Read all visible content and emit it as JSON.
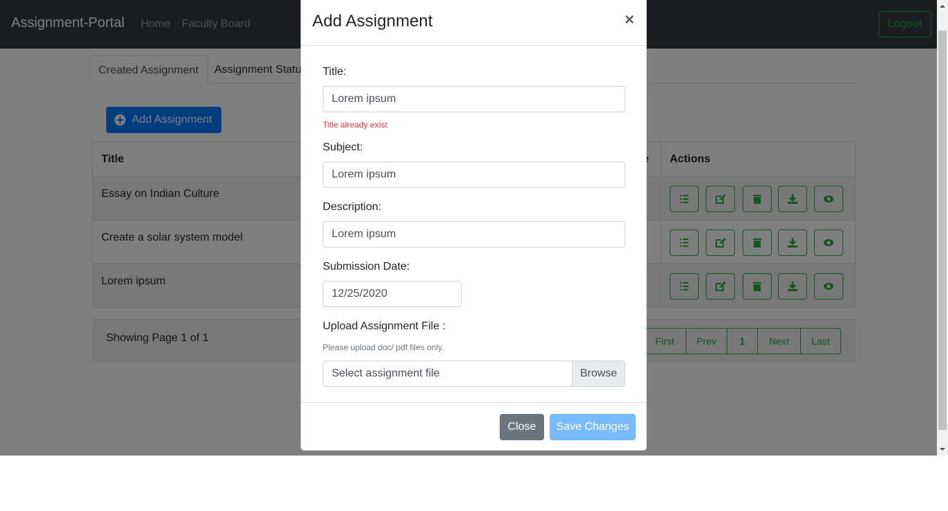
{
  "navbar": {
    "brand": "Assignment-Portal",
    "links": [
      "Home",
      "Faculty Board"
    ],
    "logout": "Logout"
  },
  "tabs": [
    "Created Assignment",
    "Assignment Status"
  ],
  "add_button": {
    "label": "Add Assignment",
    "icon": "plus-circle-icon"
  },
  "table": {
    "headers": {
      "title": "Title",
      "partial": "e",
      "actions": "Actions"
    },
    "rows": [
      {
        "title": "Essay on Indian Culture"
      },
      {
        "title": "Create a solar system model"
      },
      {
        "title": "Lorem ipsum"
      }
    ],
    "action_icons": [
      "list-check-icon",
      "edit-icon",
      "trash-icon",
      "download-icon",
      "eye-icon"
    ]
  },
  "pagination": {
    "info": "Showing Page 1 of 1",
    "first": "First",
    "prev": "Prev",
    "page": "1",
    "next": "Next",
    "last": "Last"
  },
  "modal": {
    "title": "Add Assignment",
    "close_symbol": "×",
    "fields": {
      "title_label": "Title:",
      "title_value": "Lorem ipsum",
      "title_error": "Title already exist",
      "subject_label": "Subject:",
      "subject_value": "Lorem ipsum",
      "description_label": "Description:",
      "description_value": "Lorem ipsum",
      "date_label": "Submission Date:",
      "date_value": "12/25/2020",
      "file_label": "Upload Assignment File :",
      "file_help": "Please upload doc/ pdf files only.",
      "file_placeholder": "Select assignment file",
      "browse": "Browse"
    },
    "close_button": "Close",
    "save_button": "Save Changes"
  },
  "colors": {
    "navbar": "#343a40",
    "primary": "#007bff",
    "success": "#28a745",
    "danger": "#dc3545",
    "secondary": "#6c757d"
  }
}
